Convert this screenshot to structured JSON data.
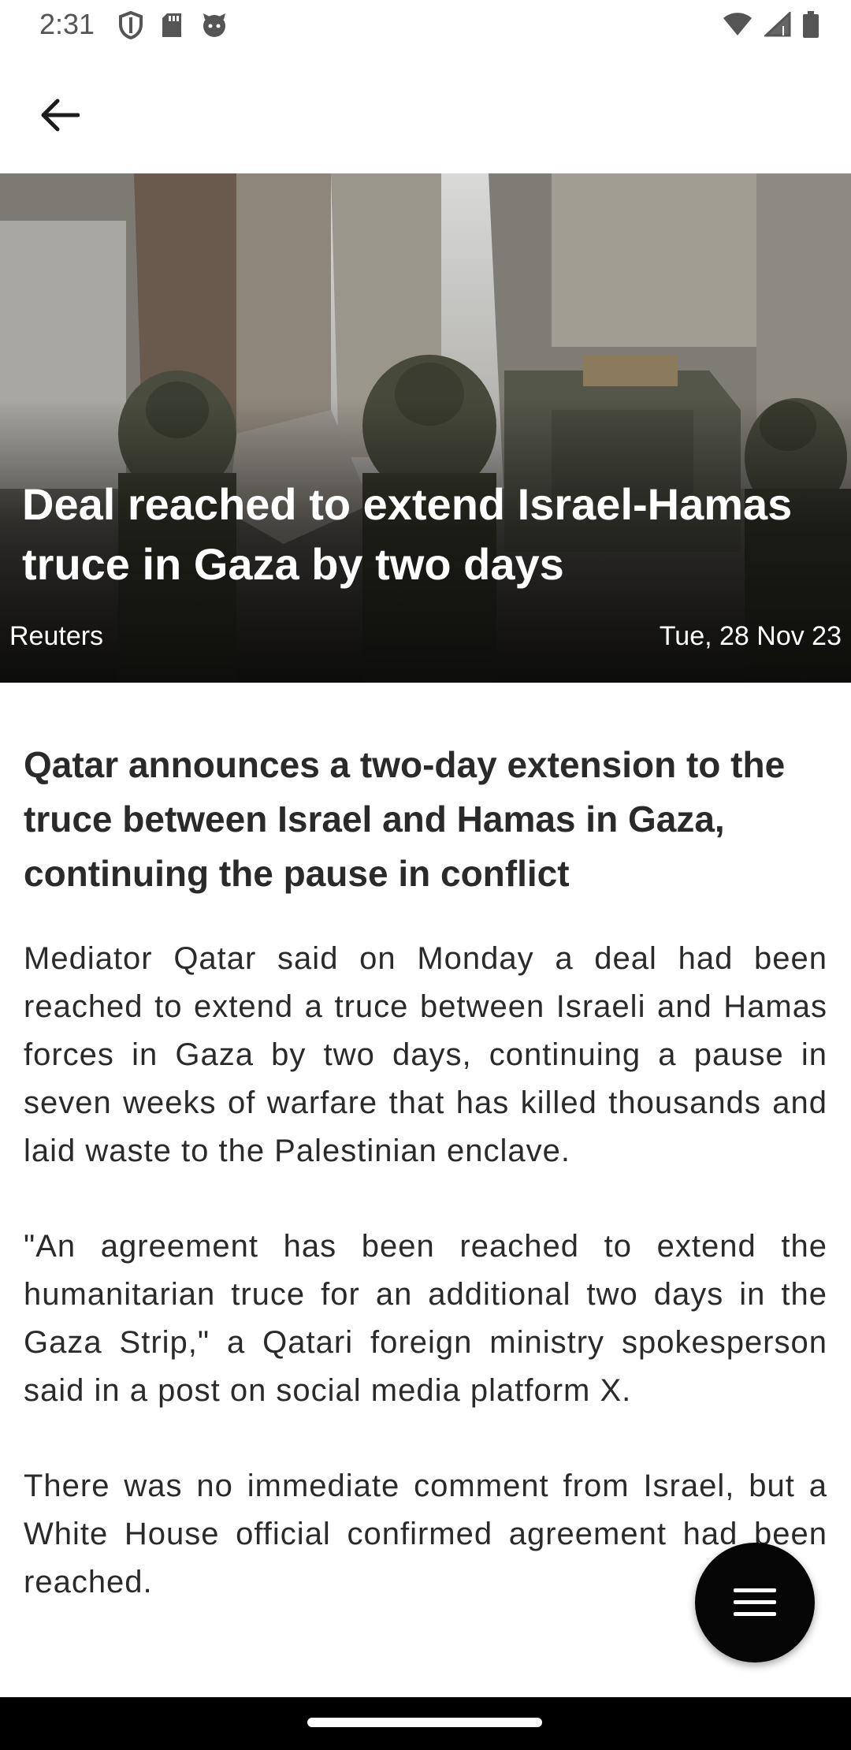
{
  "status_bar": {
    "time": "2:31",
    "left_icons": [
      "shield-icon",
      "sd-card-icon",
      "face-icon"
    ],
    "right_icons": [
      "wifi-icon",
      "signal-icon",
      "battery-icon"
    ]
  },
  "app_bar": {
    "back_icon": "arrow-back-icon"
  },
  "article": {
    "title": "Deal reached to extend Israel-Hamas truce in Gaza by two days",
    "source": "Reuters",
    "date": "Tue, 28 Nov 23",
    "subtitle": "Qatar announces a two-day extension to the truce between Israel and Hamas in Gaza, continuing the pause in conflict",
    "paragraphs": [
      "Mediator Qatar said on Monday a deal had been reached to extend a truce between Israeli and Hamas forces in Gaza by two days, continuing a pause in seven weeks of warfare that has killed thousands and laid waste to the Palestinian enclave.",
      "\"An agreement has been reached to extend the humanitarian truce for an additional two days in the Gaza Strip,\" a Qatari foreign ministry spokesperson said in a post on social media platform X.",
      "There was no immediate comment from Israel, but a White House official confirmed agreement had been reached."
    ]
  },
  "fab": {
    "icon": "menu-icon"
  },
  "colors": {
    "fab": "#050505",
    "nav_bar": "#000000",
    "text": "#2a2a2a"
  }
}
